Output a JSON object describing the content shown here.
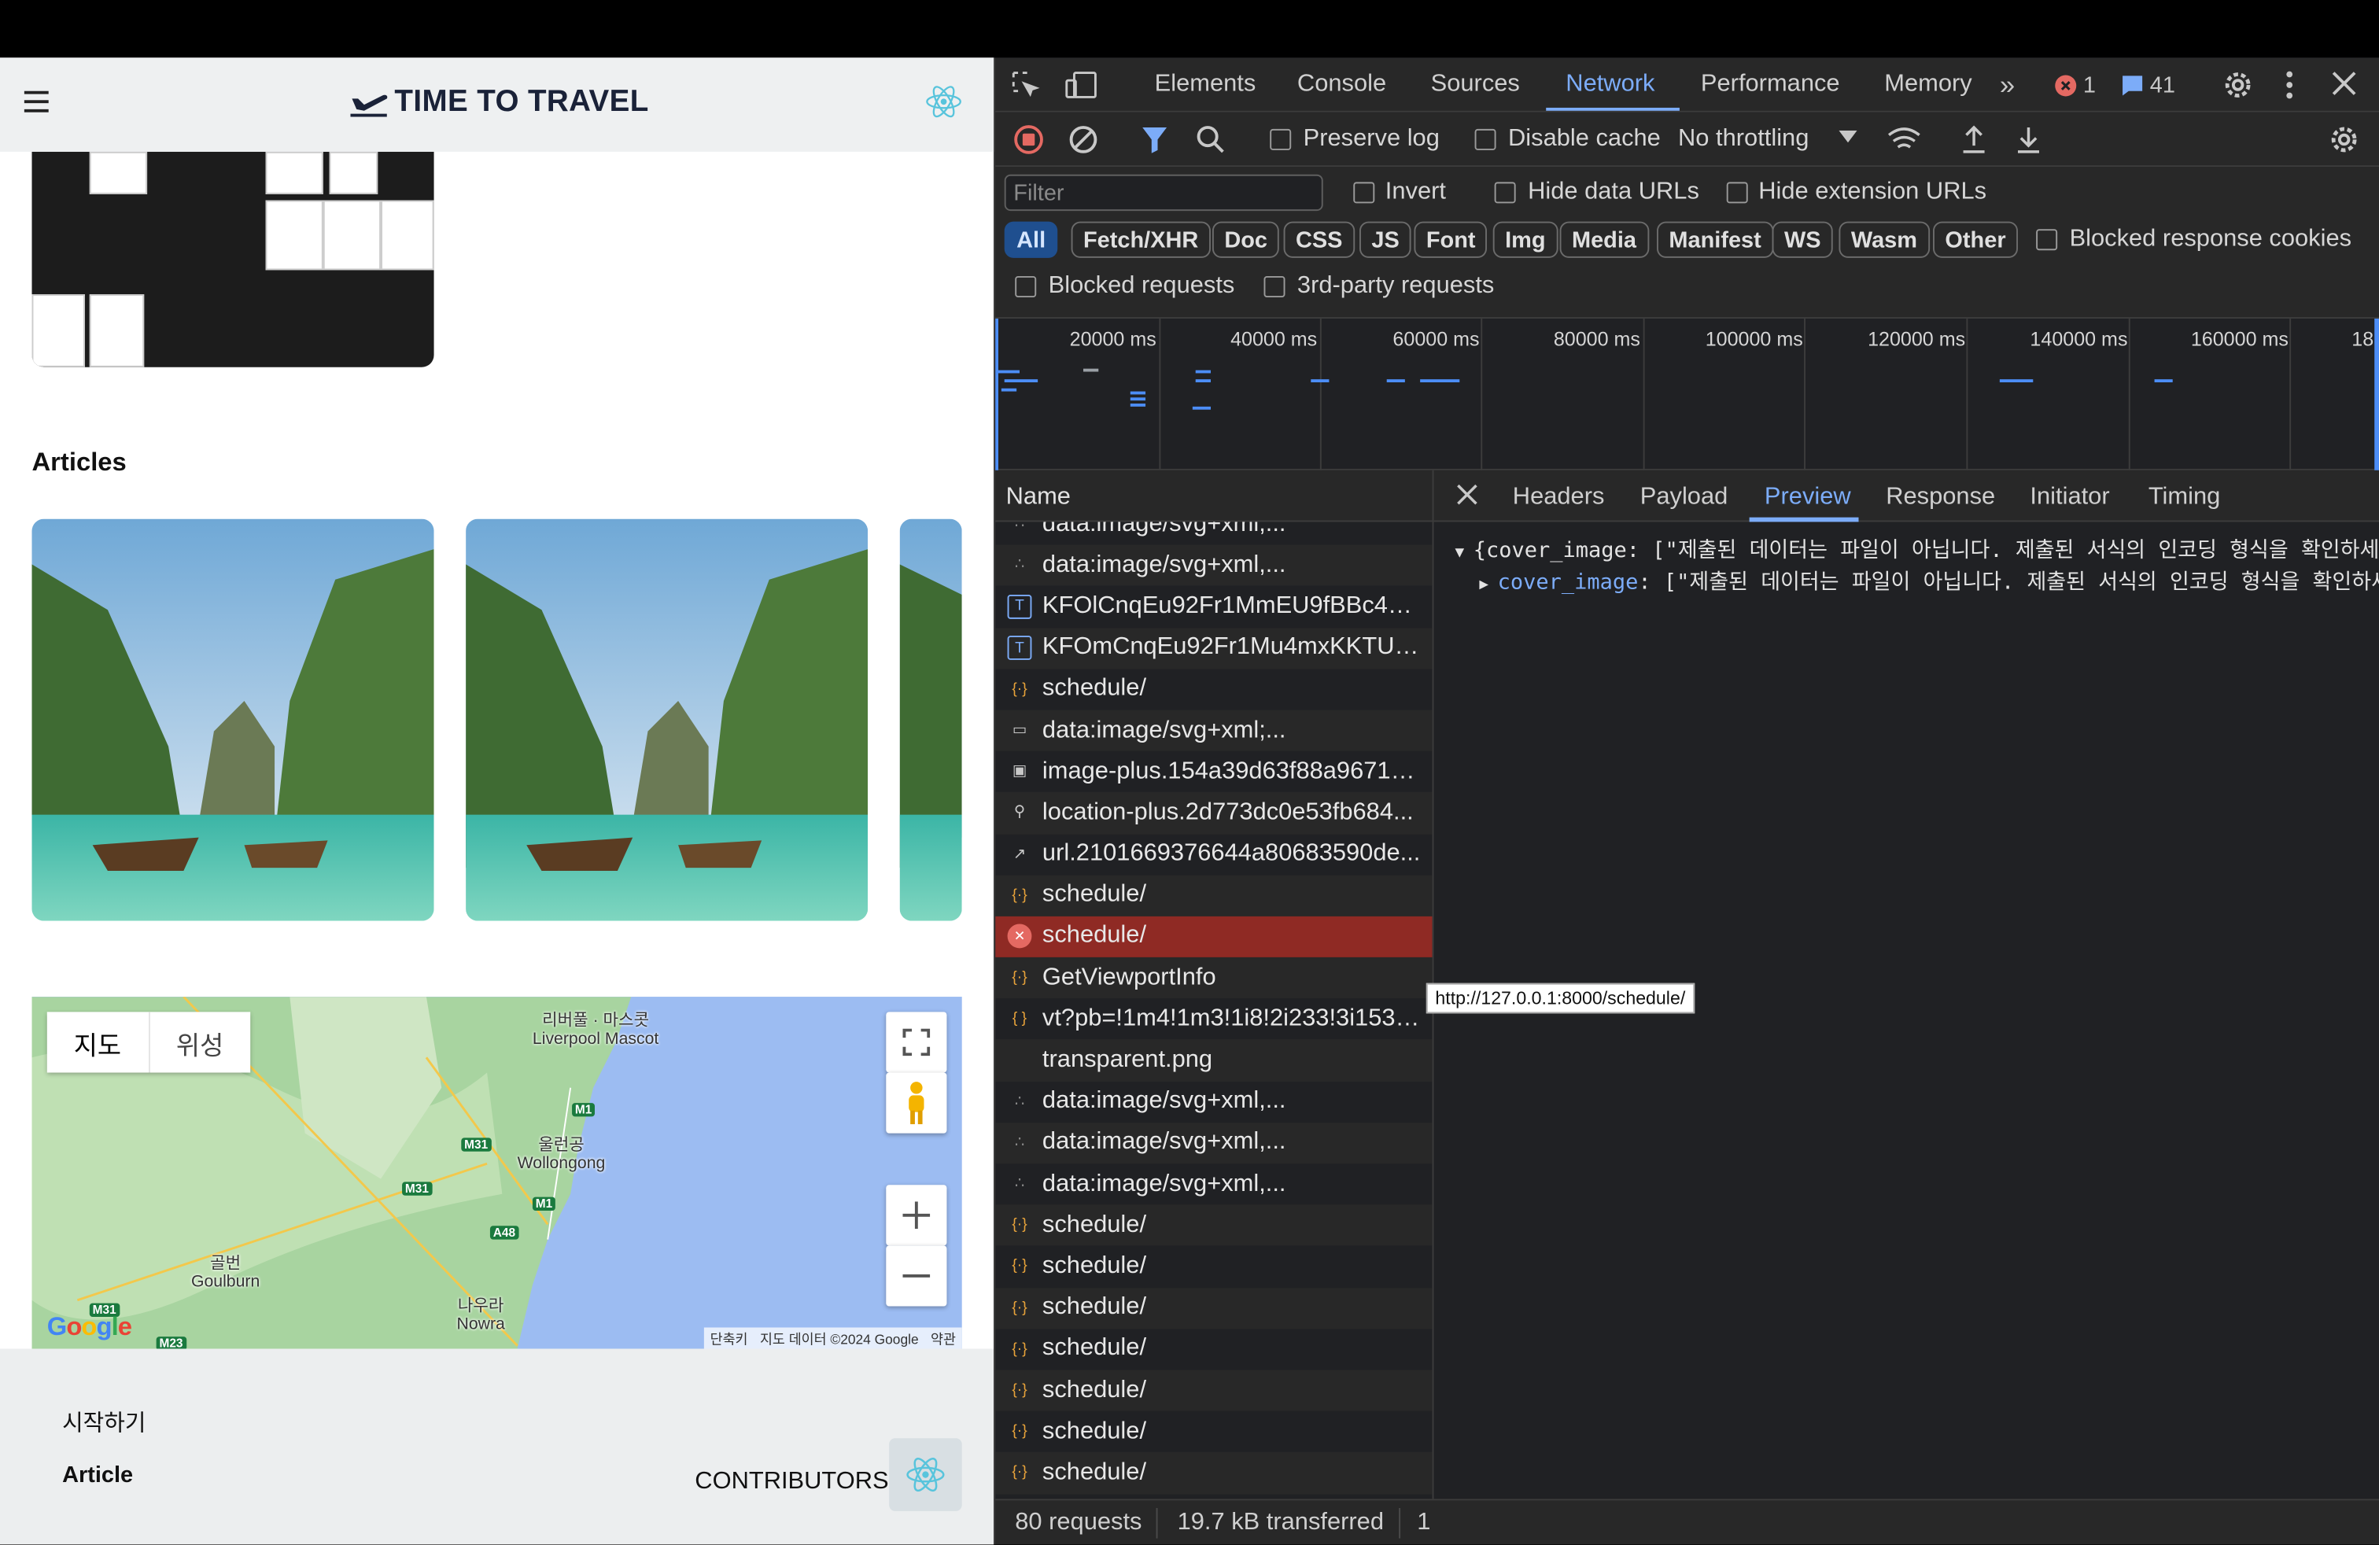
{
  "app": {
    "brand": "TIME TO TRAVEL",
    "section_title": "Articles",
    "map": {
      "toggle_map": "지도",
      "toggle_satellite": "위성",
      "labels": [
        {
          "ko": "리버풀 · 마스콧",
          "en": "Liverpool Mascot"
        },
        {
          "ko": "울런공",
          "en": "Wollongong"
        },
        {
          "ko": "골번",
          "en": "Goulburn"
        },
        {
          "ko": "나우라",
          "en": "Nowra"
        }
      ],
      "roads": [
        "M1",
        "M31",
        "M31",
        "M1",
        "A48",
        "M31",
        "M23"
      ],
      "attribution": [
        "단축키",
        "지도 데이터 ©2024 Google",
        "약관"
      ],
      "logo": "Google"
    },
    "footer": {
      "start": "시작하기",
      "article": "Article",
      "contributors": "CONTRIBUTORS"
    }
  },
  "devtools": {
    "tabs": [
      "Elements",
      "Console",
      "Sources",
      "Network",
      "Performance",
      "Memory"
    ],
    "active_tab": "Network",
    "error_count": "1",
    "message_count": "41",
    "toolbar": {
      "preserve_log": "Preserve log",
      "disable_cache": "Disable cache",
      "throttling": "No throttling"
    },
    "filter": {
      "placeholder": "Filter",
      "invert": "Invert",
      "hide_data_urls": "Hide data URLs",
      "hide_extension_urls": "Hide extension URLs",
      "types": [
        "All",
        "Fetch/XHR",
        "Doc",
        "CSS",
        "JS",
        "Font",
        "Img",
        "Media",
        "Manifest",
        "WS",
        "Wasm",
        "Other"
      ],
      "blocked_response_cookies": "Blocked response cookies",
      "blocked_requests": "Blocked requests",
      "third_party": "3rd-party requests"
    },
    "timeline_labels": [
      "20000 ms",
      "40000 ms",
      "60000 ms",
      "80000 ms",
      "100000 ms",
      "120000 ms",
      "140000 ms",
      "160000 ms",
      "18"
    ],
    "name_header": "Name",
    "requests": [
      {
        "name": "data:image/svg+xml,...",
        "icon": "svg-icon"
      },
      {
        "name": "data:image/svg+xml,...",
        "icon": "svg-icon"
      },
      {
        "name": "KFOlCnqEu92Fr1MmEU9fBBc4A...",
        "icon": "font-icon"
      },
      {
        "name": "KFOmCnqEu92Fr1Mu4mxKKTU1...",
        "icon": "font-icon"
      },
      {
        "name": "schedule/",
        "icon": "fetch-icon"
      },
      {
        "name": "data:image/svg+xml;...",
        "icon": "doc-icon"
      },
      {
        "name": "image-plus.154a39d63f88a96717...",
        "icon": "image-icon"
      },
      {
        "name": "location-plus.2d773dc0e53fb684...",
        "icon": "pin-icon"
      },
      {
        "name": "url.2101669376644a80683590de...",
        "icon": "link-icon"
      },
      {
        "name": "schedule/",
        "icon": "fetch-icon"
      },
      {
        "name": "schedule/",
        "icon": "error-icon",
        "error": true
      },
      {
        "name": "GetViewportInfo",
        "icon": "fetch-icon"
      },
      {
        "name": "vt?pb=!1m4!1m3!1i8!2i233!3i153!...",
        "icon": "script-icon"
      },
      {
        "name": "transparent.png",
        "icon": "none"
      },
      {
        "name": "data:image/svg+xml,...",
        "icon": "svg-icon"
      },
      {
        "name": "data:image/svg+xml,...",
        "icon": "svg-icon"
      },
      {
        "name": "data:image/svg+xml,...",
        "icon": "svg-icon"
      },
      {
        "name": "schedule/",
        "icon": "fetch-icon"
      },
      {
        "name": "schedule/",
        "icon": "fetch-icon"
      },
      {
        "name": "schedule/",
        "icon": "fetch-icon"
      },
      {
        "name": "schedule/",
        "icon": "fetch-icon"
      },
      {
        "name": "schedule/",
        "icon": "fetch-icon"
      },
      {
        "name": "schedule/",
        "icon": "fetch-icon"
      },
      {
        "name": "schedule/",
        "icon": "fetch-icon"
      }
    ],
    "detail_tabs": [
      "Headers",
      "Payload",
      "Preview",
      "Response",
      "Initiator",
      "Timing"
    ],
    "active_detail_tab": "Preview",
    "preview": {
      "line1": "{cover_image: [\"제출된 데이터는 파일이 아닙니다. 제출된 서식의 인코딩 형식을 확인하세요.\"]}",
      "line2_key": "cover_image",
      "line2_val": ": [\"제출된 데이터는 파일이 아닙니다. 제출된 서식의 인코딩 형식을 확인하세요.\"]"
    },
    "tooltip": "http://127.0.0.1:8000/schedule/",
    "status": {
      "requests": "80 requests",
      "transferred": "19.7 kB transferred",
      "resources": "1"
    },
    "colors": {
      "accent": "#7cacf8",
      "error_row": "#8f2a24",
      "bar": "#4c8df6"
    }
  }
}
